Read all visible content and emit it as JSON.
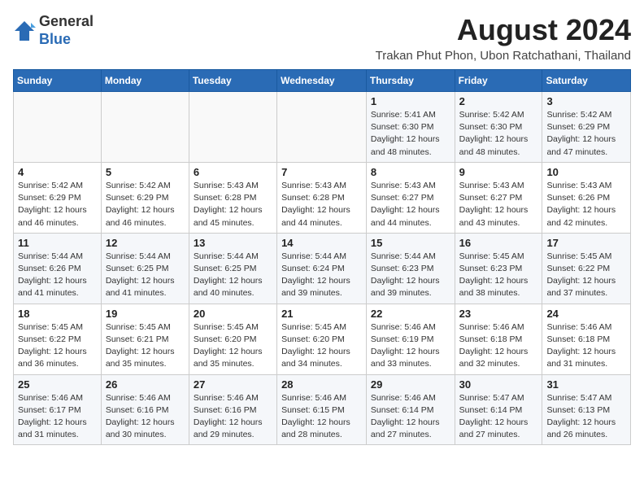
{
  "header": {
    "logo_general": "General",
    "logo_blue": "Blue",
    "month_year": "August 2024",
    "location": "Trakan Phut Phon, Ubon Ratchathani, Thailand"
  },
  "weekdays": [
    "Sunday",
    "Monday",
    "Tuesday",
    "Wednesday",
    "Thursday",
    "Friday",
    "Saturday"
  ],
  "weeks": [
    [
      {
        "day": "",
        "info": ""
      },
      {
        "day": "",
        "info": ""
      },
      {
        "day": "",
        "info": ""
      },
      {
        "day": "",
        "info": ""
      },
      {
        "day": "1",
        "info": "Sunrise: 5:41 AM\nSunset: 6:30 PM\nDaylight: 12 hours and 48 minutes."
      },
      {
        "day": "2",
        "info": "Sunrise: 5:42 AM\nSunset: 6:30 PM\nDaylight: 12 hours and 48 minutes."
      },
      {
        "day": "3",
        "info": "Sunrise: 5:42 AM\nSunset: 6:29 PM\nDaylight: 12 hours and 47 minutes."
      }
    ],
    [
      {
        "day": "4",
        "info": "Sunrise: 5:42 AM\nSunset: 6:29 PM\nDaylight: 12 hours and 46 minutes."
      },
      {
        "day": "5",
        "info": "Sunrise: 5:42 AM\nSunset: 6:29 PM\nDaylight: 12 hours and 46 minutes."
      },
      {
        "day": "6",
        "info": "Sunrise: 5:43 AM\nSunset: 6:28 PM\nDaylight: 12 hours and 45 minutes."
      },
      {
        "day": "7",
        "info": "Sunrise: 5:43 AM\nSunset: 6:28 PM\nDaylight: 12 hours and 44 minutes."
      },
      {
        "day": "8",
        "info": "Sunrise: 5:43 AM\nSunset: 6:27 PM\nDaylight: 12 hours and 44 minutes."
      },
      {
        "day": "9",
        "info": "Sunrise: 5:43 AM\nSunset: 6:27 PM\nDaylight: 12 hours and 43 minutes."
      },
      {
        "day": "10",
        "info": "Sunrise: 5:43 AM\nSunset: 6:26 PM\nDaylight: 12 hours and 42 minutes."
      }
    ],
    [
      {
        "day": "11",
        "info": "Sunrise: 5:44 AM\nSunset: 6:26 PM\nDaylight: 12 hours and 41 minutes."
      },
      {
        "day": "12",
        "info": "Sunrise: 5:44 AM\nSunset: 6:25 PM\nDaylight: 12 hours and 41 minutes."
      },
      {
        "day": "13",
        "info": "Sunrise: 5:44 AM\nSunset: 6:25 PM\nDaylight: 12 hours and 40 minutes."
      },
      {
        "day": "14",
        "info": "Sunrise: 5:44 AM\nSunset: 6:24 PM\nDaylight: 12 hours and 39 minutes."
      },
      {
        "day": "15",
        "info": "Sunrise: 5:44 AM\nSunset: 6:23 PM\nDaylight: 12 hours and 39 minutes."
      },
      {
        "day": "16",
        "info": "Sunrise: 5:45 AM\nSunset: 6:23 PM\nDaylight: 12 hours and 38 minutes."
      },
      {
        "day": "17",
        "info": "Sunrise: 5:45 AM\nSunset: 6:22 PM\nDaylight: 12 hours and 37 minutes."
      }
    ],
    [
      {
        "day": "18",
        "info": "Sunrise: 5:45 AM\nSunset: 6:22 PM\nDaylight: 12 hours and 36 minutes."
      },
      {
        "day": "19",
        "info": "Sunrise: 5:45 AM\nSunset: 6:21 PM\nDaylight: 12 hours and 35 minutes."
      },
      {
        "day": "20",
        "info": "Sunrise: 5:45 AM\nSunset: 6:20 PM\nDaylight: 12 hours and 35 minutes."
      },
      {
        "day": "21",
        "info": "Sunrise: 5:45 AM\nSunset: 6:20 PM\nDaylight: 12 hours and 34 minutes."
      },
      {
        "day": "22",
        "info": "Sunrise: 5:46 AM\nSunset: 6:19 PM\nDaylight: 12 hours and 33 minutes."
      },
      {
        "day": "23",
        "info": "Sunrise: 5:46 AM\nSunset: 6:18 PM\nDaylight: 12 hours and 32 minutes."
      },
      {
        "day": "24",
        "info": "Sunrise: 5:46 AM\nSunset: 6:18 PM\nDaylight: 12 hours and 31 minutes."
      }
    ],
    [
      {
        "day": "25",
        "info": "Sunrise: 5:46 AM\nSunset: 6:17 PM\nDaylight: 12 hours and 31 minutes."
      },
      {
        "day": "26",
        "info": "Sunrise: 5:46 AM\nSunset: 6:16 PM\nDaylight: 12 hours and 30 minutes."
      },
      {
        "day": "27",
        "info": "Sunrise: 5:46 AM\nSunset: 6:16 PM\nDaylight: 12 hours and 29 minutes."
      },
      {
        "day": "28",
        "info": "Sunrise: 5:46 AM\nSunset: 6:15 PM\nDaylight: 12 hours and 28 minutes."
      },
      {
        "day": "29",
        "info": "Sunrise: 5:46 AM\nSunset: 6:14 PM\nDaylight: 12 hours and 27 minutes."
      },
      {
        "day": "30",
        "info": "Sunrise: 5:47 AM\nSunset: 6:14 PM\nDaylight: 12 hours and 27 minutes."
      },
      {
        "day": "31",
        "info": "Sunrise: 5:47 AM\nSunset: 6:13 PM\nDaylight: 12 hours and 26 minutes."
      }
    ]
  ]
}
